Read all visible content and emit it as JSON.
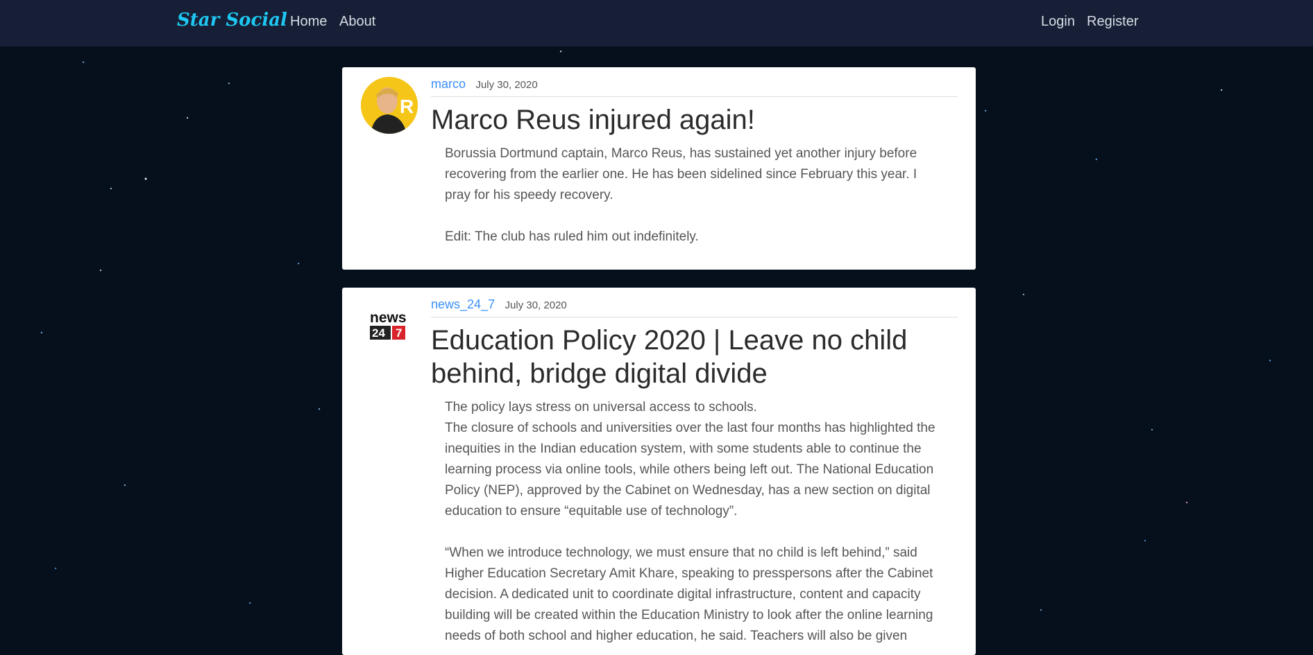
{
  "navbar": {
    "brand": "Star Social",
    "links": [
      "Home",
      "About"
    ],
    "auth": [
      "Login",
      "Register"
    ]
  },
  "posts": [
    {
      "username": "marco",
      "date": "July 30, 2020",
      "title": "Marco Reus injured again!",
      "body": "Borussia Dortmund captain, Marco Reus, has sustained yet another injury before recovering from the earlier one. He has been sidelined since February this year. I pray for his speedy recovery.\n\nEdit: The club has ruled him out indefinitely.",
      "avatar_icon": "player-photo-avatar",
      "avatar_letters": "R"
    },
    {
      "username": "news_24_7",
      "date": "July 30, 2020",
      "title": "Education Policy 2020 | Leave no child behind, bridge digital divide",
      "body": "The policy lays stress on universal access to schools.\nThe closure of schools and universities over the last four months has highlighted the inequities in the Indian education system, with some students able to continue the learning process via online tools, while others being left out. The National Education Policy (NEP), approved by the Cabinet on Wednesday, has a new section on digital education to ensure “equitable use of technology”.\n\n“When we introduce technology, we must ensure that no child is left behind,” said Higher Education Secretary Amit Khare, speaking to presspersons after the Cabinet decision. A dedicated unit to coordinate digital infrastructure, content and capacity building will be created within the Education Ministry to look after the online learning needs of both school and higher education, he said. Teachers will also be given",
      "avatar_icon": "news247-logo-avatar",
      "logo_word": "news",
      "logo_num1": "24",
      "logo_num2": "7"
    }
  ],
  "colors": {
    "navbar": "#161f35",
    "brand": "#1ec8f3",
    "username": "#3a8ff7",
    "background": "#06101d"
  }
}
